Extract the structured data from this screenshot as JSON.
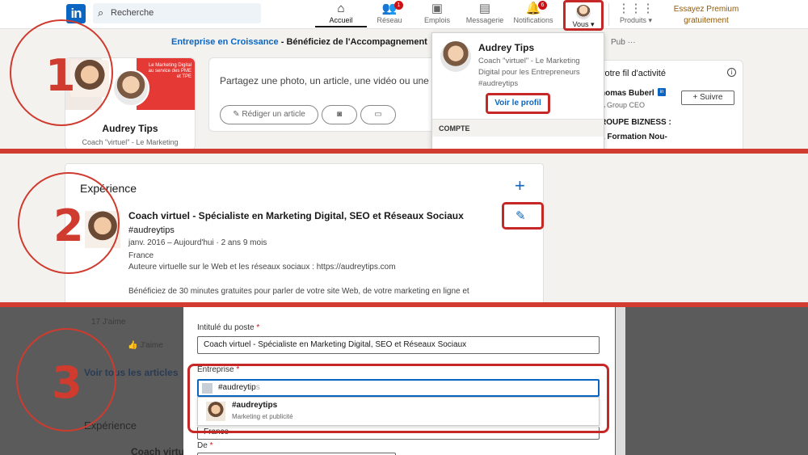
{
  "annotations": {
    "step1": "1",
    "step2": "2",
    "step3": "3"
  },
  "colors": {
    "annotation_red": "#d13b30",
    "linkedin_blue": "#0a66c2",
    "premium_gold": "#915907"
  },
  "navbar": {
    "logo": "in",
    "search_placeholder": "Recherche",
    "items": [
      {
        "label": "Accueil",
        "icon": "home-icon",
        "badge": ""
      },
      {
        "label": "Réseau",
        "icon": "network-icon",
        "badge": "1"
      },
      {
        "label": "Emplois",
        "icon": "briefcase-icon",
        "badge": ""
      },
      {
        "label": "Messagerie",
        "icon": "messaging-icon",
        "badge": ""
      },
      {
        "label": "Notifications",
        "icon": "bell-icon",
        "badge": "6"
      }
    ],
    "me_label": "Vous",
    "products_label": "Produits",
    "premium_line1": "Essayez Premium",
    "premium_line2": "gratuitement"
  },
  "banner": {
    "link": "Entreprise en Croissance",
    "separator": " - ",
    "text": "Bénéficiez de l'Accompagnement",
    "pub": "Pub",
    "more": "···"
  },
  "profile_card": {
    "cover_text": "Le Marketing Digital au service des PME et TPE",
    "name": "Audrey Tips",
    "subtitle": "Coach \"virtuel\" - Le Marketing"
  },
  "share_box": {
    "prompt": "Partagez une photo, un article, une vidéo ou une ic",
    "write_article": "Rédiger un article"
  },
  "right_card": {
    "title": "votre fil d'activité",
    "person_name": "homas Buberl",
    "person_sub": "A Group CEO",
    "follow_label": "+ Suivre",
    "group_title": "ROUPE BIZNESS :",
    "group_sub": "1 Formation Nou-"
  },
  "me_dropdown": {
    "name": "Audrey Tips",
    "subtitle": "Coach \"virtuel\" - Le Marketing Digital pour les Entrepreneurs #audreytips",
    "view_profile": "Voir le profil",
    "section": "COMPTE"
  },
  "experience": {
    "title": "Expérience",
    "role": "Coach virtuel - Spécialiste en Marketing Digital, SEO et Réseaux Sociaux",
    "company": "#audreytips",
    "dates": "janv. 2016 – Aujourd'hui",
    "duration": "2 ans 9 mois",
    "location": "France",
    "description": "Auteure virtuelle sur le Web et les réseaux sociaux : https://audreytips.com",
    "description2": "Bénéficiez de 30 minutes gratuites pour parler de votre site Web, de votre marketing en ligne et"
  },
  "background_page": {
    "likes": "17 J'aime",
    "like_label": "J'aime",
    "see_all": "Voir tous les articles",
    "exp_title": "Expérience",
    "exp_role": "Coach virtue"
  },
  "edit_modal": {
    "job_title_label": "Intitulé du poste",
    "job_title_value": "Coach virtuel - Spécialiste en Marketing Digital, SEO et Réseaux Sociaux",
    "company_label": "Entreprise",
    "company_value": "#audreytip",
    "company_ghost": "s",
    "suggestion_name": "#audreytips",
    "suggestion_sub": "Marketing et publicité",
    "location_value": "France",
    "from_label": "De",
    "required": "*"
  }
}
